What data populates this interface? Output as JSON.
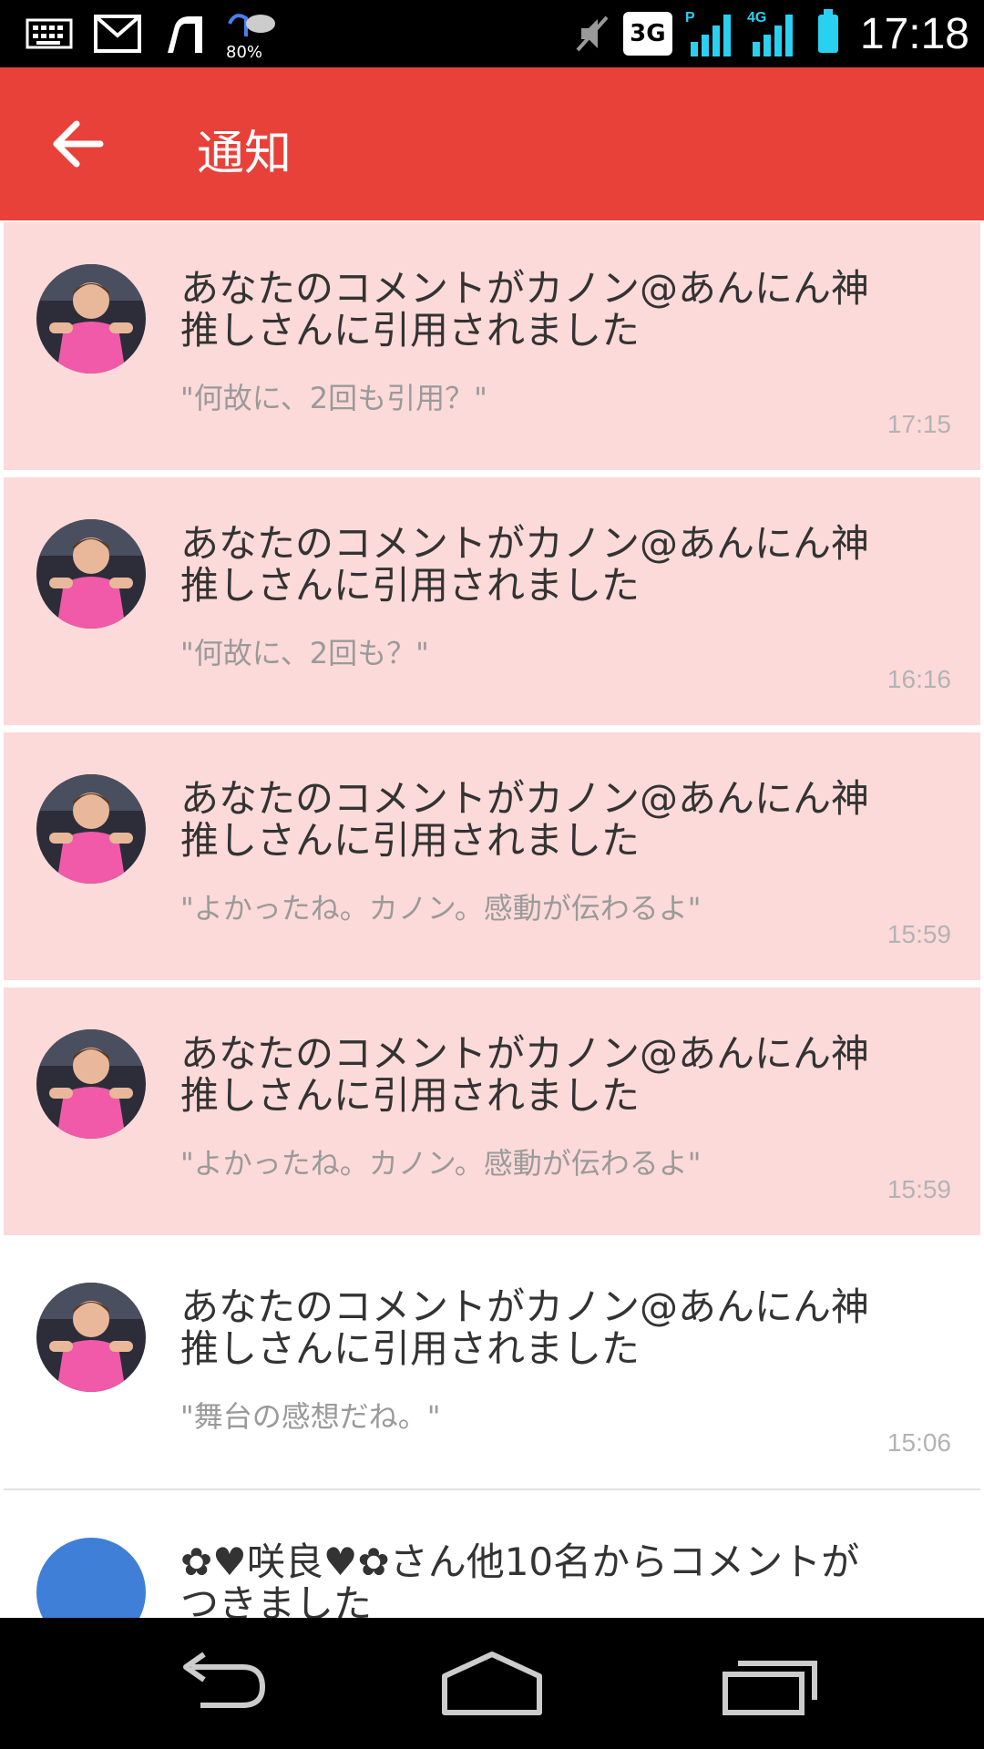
{
  "status_bar": {
    "weather_pct": "80%",
    "network": "3G",
    "time": "17:18",
    "icons": [
      "keyboard-icon",
      "gmail-icon",
      "app-icon",
      "weather-icon",
      "mute-icon",
      "signal-p-icon",
      "signal-4g-icon",
      "battery-icon"
    ]
  },
  "header": {
    "title": "通知",
    "back_icon": "arrow-left-icon",
    "color": "#e8413a"
  },
  "notifications": [
    {
      "title": "あなたのコメントがカノン@あんにん神推しさんに引用されました",
      "quote": "\"何故に、2回も引用？\"",
      "time": "17:15",
      "unread": true
    },
    {
      "title": "あなたのコメントがカノン@あんにん神推しさんに引用されました",
      "quote": "\"何故に、2回も？\"",
      "time": "16:16",
      "unread": true
    },
    {
      "title": "あなたのコメントがカノン@あんにん神推しさんに引用されました",
      "quote": "\"よかったね。カノン。感動が伝わるよ\"",
      "time": "15:59",
      "unread": true
    },
    {
      "title": "あなたのコメントがカノン@あんにん神推しさんに引用されました",
      "quote": "\"よかったね。カノン。感動が伝わるよ\"",
      "time": "15:59",
      "unread": true
    },
    {
      "title": "あなたのコメントがカノン@あんにん神推しさんに引用されました",
      "quote": "\"舞台の感想だね。\"",
      "time": "15:06",
      "unread": false
    },
    {
      "title": "✿♥咲良♥✿さん他10名からコメントがつきました",
      "quote": "",
      "time": "",
      "unread": false
    }
  ],
  "nav_bar": {
    "icons": [
      "back-icon",
      "home-icon",
      "recents-icon"
    ]
  },
  "colors": {
    "unread_bg": "#fcdad9",
    "read_bg": "#ffffff",
    "battery": "#2ad0f0"
  }
}
